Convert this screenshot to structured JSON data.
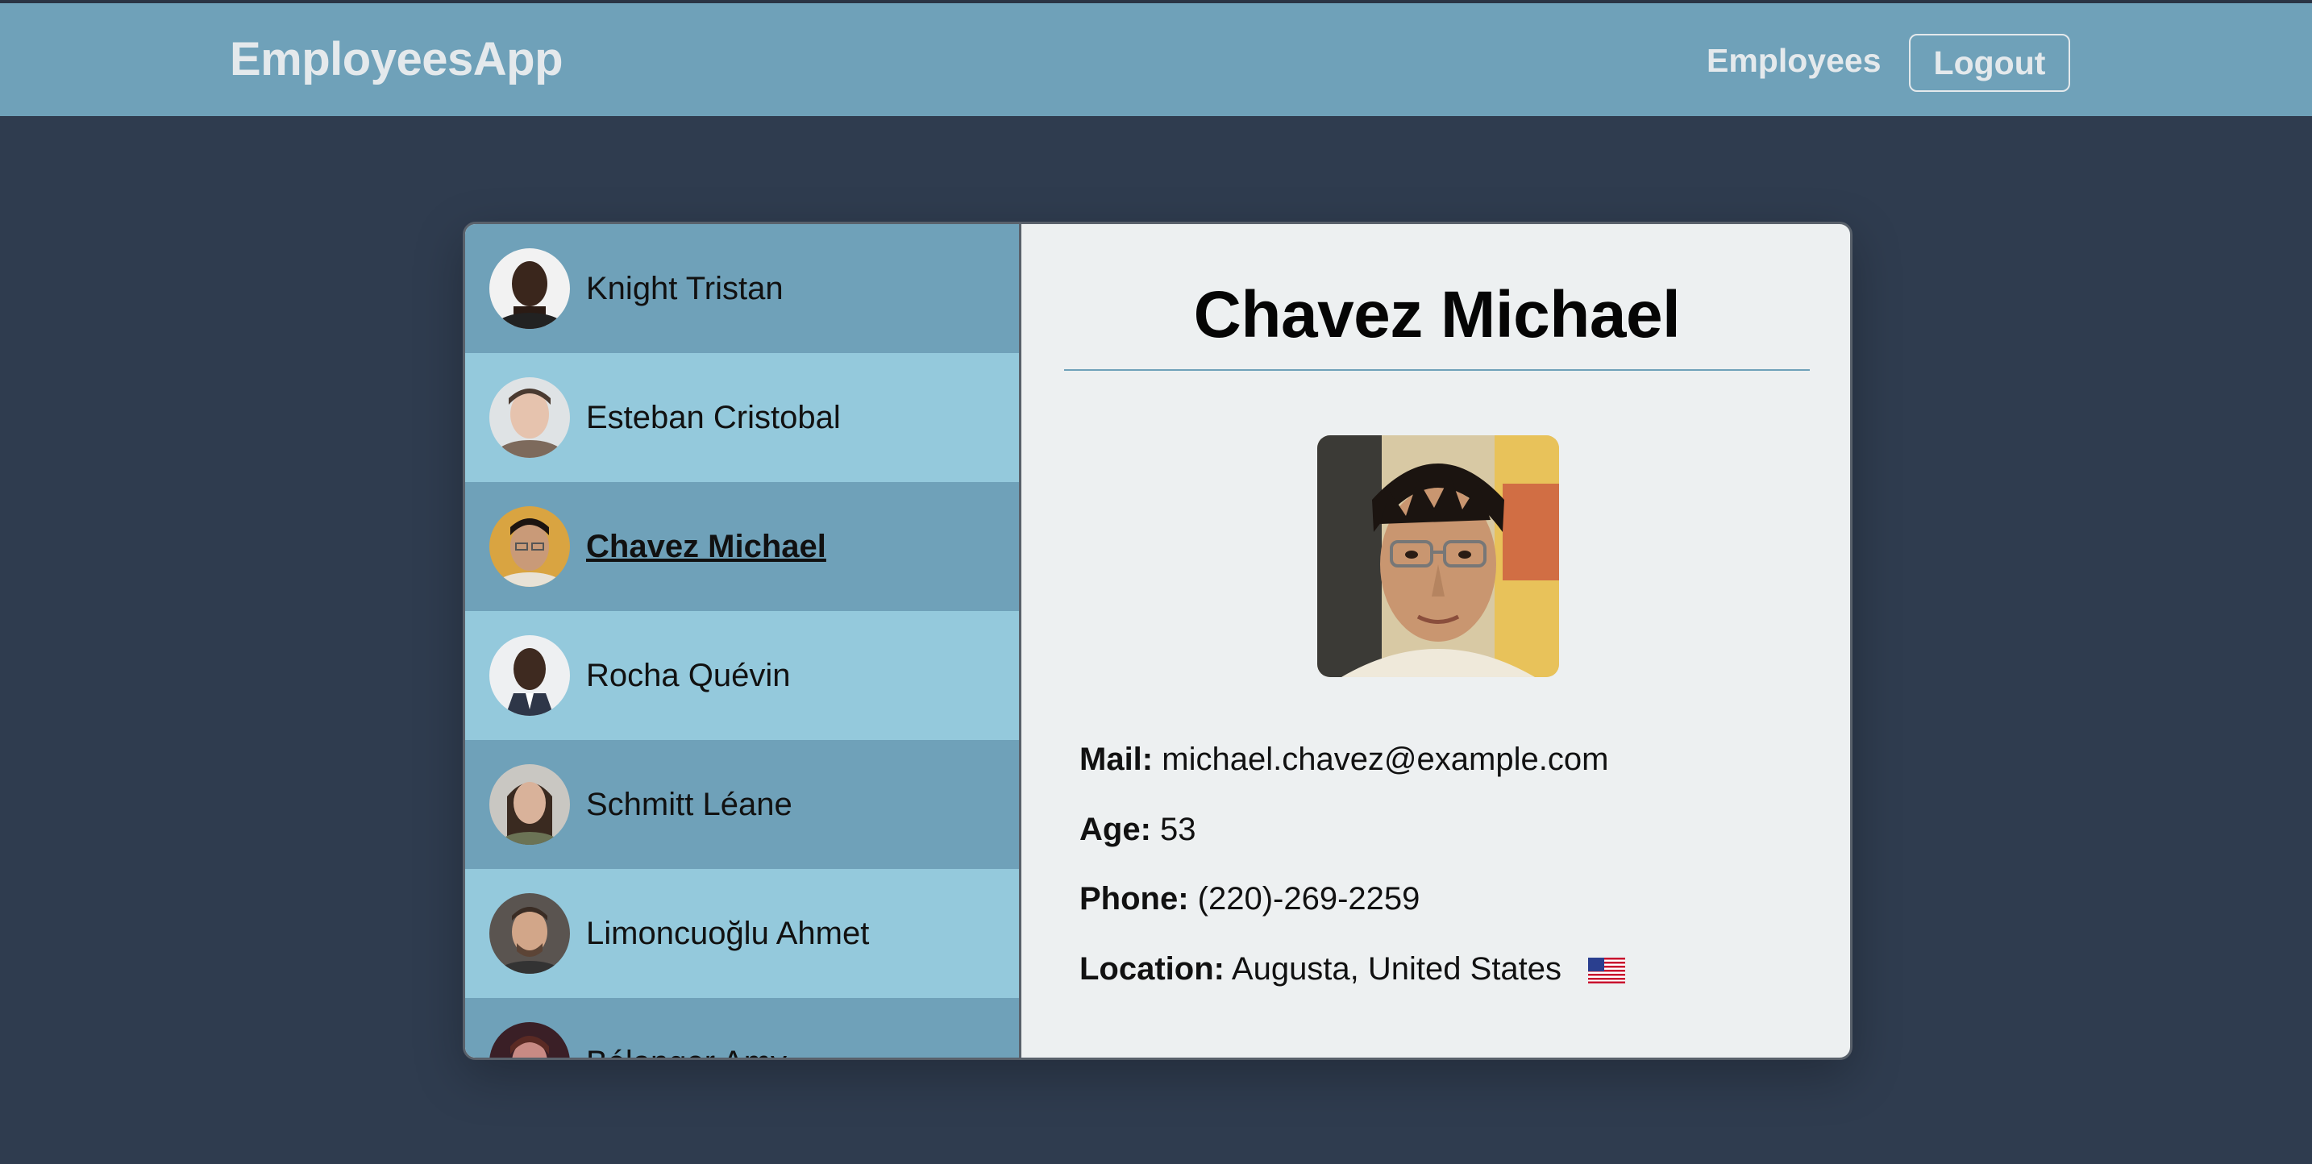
{
  "header": {
    "brand": "EmployeesApp",
    "nav_employees": "Employees",
    "logout_label": "Logout"
  },
  "colors": {
    "background": "#2f3c4f",
    "header": "#6fa1b9",
    "list_dark": "#6fa1b9",
    "list_light": "#94c9dc",
    "detail_bg": "#edf0f1"
  },
  "employees": [
    {
      "name": "Knight Tristan"
    },
    {
      "name": "Esteban Cristobal"
    },
    {
      "name": "Chavez Michael",
      "selected": true
    },
    {
      "name": "Rocha Quévin"
    },
    {
      "name": "Schmitt Léane"
    },
    {
      "name": "Limoncuoğlu Ahmet"
    },
    {
      "name": "Bélanger Amy"
    }
  ],
  "detail": {
    "name": "Chavez Michael",
    "mail_label": "Mail:",
    "mail": "michael.chavez@example.com",
    "age_label": "Age:",
    "age": "53",
    "phone_label": "Phone:",
    "phone": "(220)-269-2259",
    "location_label": "Location:",
    "location": "Augusta, United States",
    "flag_icon": "us-flag-icon"
  }
}
